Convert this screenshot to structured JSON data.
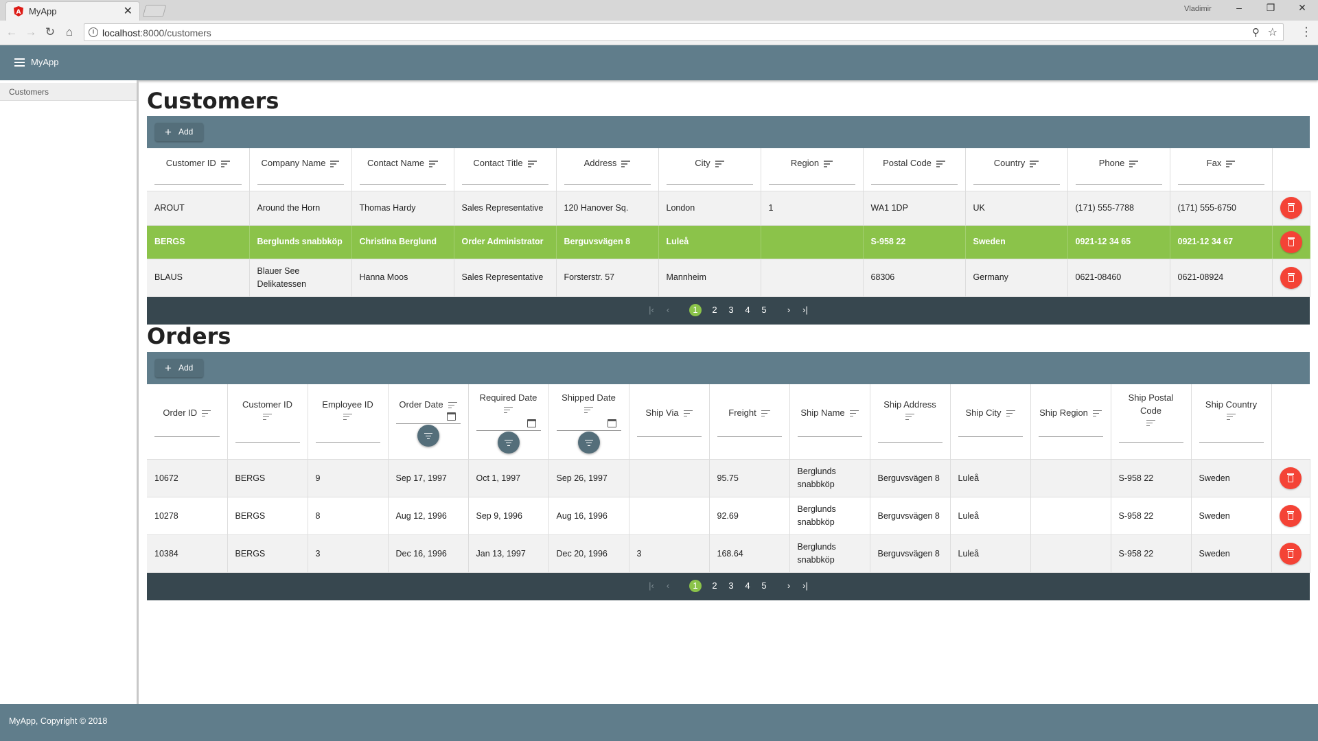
{
  "browser": {
    "tab_title": "MyApp",
    "tab_close": "✕",
    "user": "Vladimir",
    "url_host": "localhost",
    "url_path": ":8000/customers"
  },
  "app": {
    "title": "MyApp",
    "sidebar": [
      {
        "label": "Customers"
      }
    ],
    "footer": "MyApp, Copyright © 2018",
    "brand_color": "#607d8b",
    "pager_color": "#37474f",
    "selected_color": "#8bc34a",
    "delete_color": "#f44336"
  },
  "customers": {
    "title": "Customers",
    "add_label": "Add",
    "columns": [
      "Customer ID",
      "Company Name",
      "Contact Name",
      "Contact Title",
      "Address",
      "City",
      "Region",
      "Postal Code",
      "Country",
      "Phone",
      "Fax"
    ],
    "rows": [
      [
        "AROUT",
        "Around the Horn",
        "Thomas Hardy",
        "Sales Representative",
        "120 Hanover Sq.",
        "London",
        "1",
        "WA1 1DP",
        "UK",
        "(171) 555-7788",
        "(171) 555-6750"
      ],
      [
        "BERGS",
        "Berglunds snabbköp",
        "Christina Berglund",
        "Order Administrator",
        "Berguvsvägen 8",
        "Luleå",
        "",
        "S-958 22",
        "Sweden",
        "0921-12 34 65",
        "0921-12 34 67"
      ],
      [
        "BLAUS",
        "Blauer See Delikatessen",
        "Hanna Moos",
        "Sales Representative",
        "Forsterstr. 57",
        "Mannheim",
        "",
        "68306",
        "Germany",
        "0621-08460",
        "0621-08924"
      ]
    ],
    "selected_row": 1,
    "pages": [
      "1",
      "2",
      "3",
      "4",
      "5"
    ],
    "current_page": "1"
  },
  "orders": {
    "title": "Orders",
    "add_label": "Add",
    "columns": [
      "Order ID",
      "Customer ID",
      "Employee ID",
      "Order Date",
      "Required Date",
      "Shipped Date",
      "Ship Via",
      "Freight",
      "Ship Name",
      "Ship Address",
      "Ship City",
      "Ship Region",
      "Ship Postal Code",
      "Ship Country"
    ],
    "rows": [
      [
        "10672",
        "BERGS",
        "9",
        "Sep 17, 1997",
        "Oct 1, 1997",
        "Sep 26, 1997",
        "",
        "95.75",
        "Berglunds snabbköp",
        "Berguvsvägen 8",
        "Luleå",
        "",
        "S-958 22",
        "Sweden"
      ],
      [
        "10278",
        "BERGS",
        "8",
        "Aug 12, 1996",
        "Sep 9, 1996",
        "Aug 16, 1996",
        "",
        "92.69",
        "Berglunds snabbköp",
        "Berguvsvägen 8",
        "Luleå",
        "",
        "S-958 22",
        "Sweden"
      ],
      [
        "10384",
        "BERGS",
        "3",
        "Dec 16, 1996",
        "Jan 13, 1997",
        "Dec 20, 1996",
        "3",
        "168.64",
        "Berglunds snabbköp",
        "Berguvsvägen 8",
        "Luleå",
        "",
        "S-958 22",
        "Sweden"
      ]
    ],
    "pages": [
      "1",
      "2",
      "3",
      "4",
      "5"
    ],
    "current_page": "1"
  },
  "pager_icons": {
    "first": "|‹",
    "prev": "‹",
    "next": "›",
    "last": "›|"
  }
}
